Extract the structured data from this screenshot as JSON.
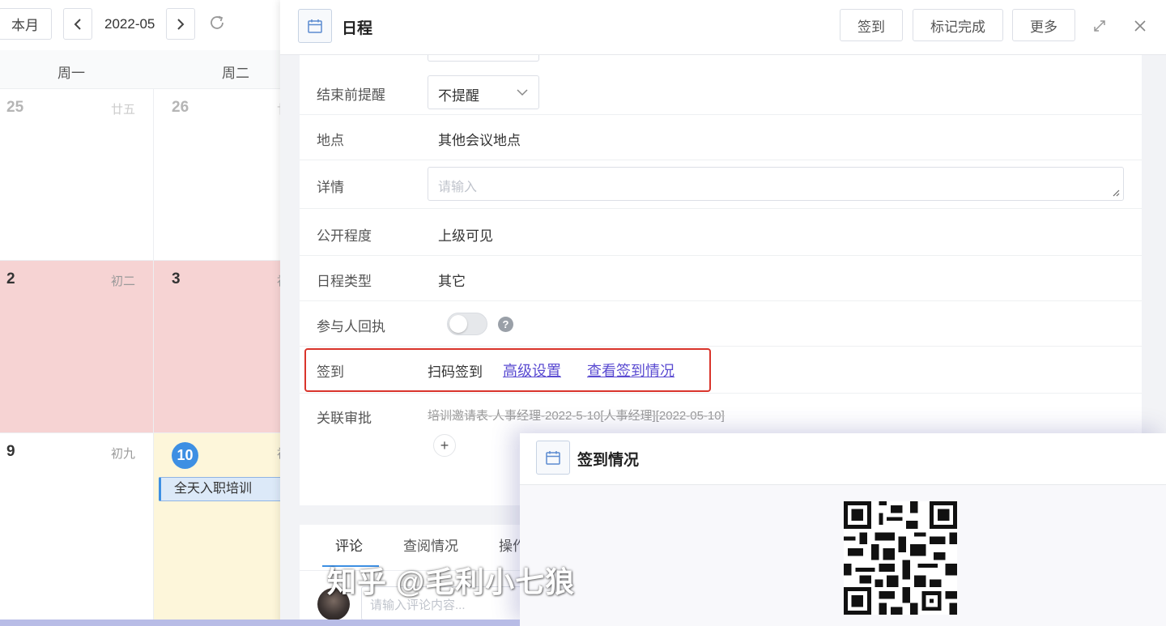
{
  "calendar": {
    "toolbar": {
      "this_month": "本月",
      "prev": "<",
      "month": "2022-05",
      "next": ">",
      "refresh_icon": "refresh-icon"
    },
    "weekdays": [
      "周一",
      "周二"
    ],
    "weeks": [
      {
        "mon": {
          "day": "25",
          "lunar": "廿五"
        },
        "tue": {
          "day": "26",
          "lunar": "廿"
        }
      },
      {
        "mon": {
          "day": "2",
          "lunar": "初二"
        },
        "tue": {
          "day": "3",
          "lunar": "初"
        }
      },
      {
        "mon": {
          "day": "9",
          "lunar": "初九"
        },
        "tue": {
          "day": "10",
          "lunar": "初"
        }
      }
    ],
    "event": "全天入职培训",
    "colors": {
      "holiday": "#f6d3d3",
      "today_col": "#fdf6da",
      "today_badge": "#3d8fe3"
    }
  },
  "drawer": {
    "title": "日程",
    "buttons": {
      "signin": "签到",
      "mark_done": "标记完成",
      "more": "更多"
    },
    "icons": {
      "calendar": "calendar-icon",
      "expand": "expand-icon",
      "close": "close-icon"
    },
    "fields": {
      "end_reminder": {
        "label": "结束前提醒",
        "value": "不提醒"
      },
      "location": {
        "label": "地点",
        "value": "其他会议地点"
      },
      "details": {
        "label": "详情",
        "placeholder": "请输入"
      },
      "visibility": {
        "label": "公开程度",
        "value": "上级可见"
      },
      "type": {
        "label": "日程类型",
        "value": "其它"
      },
      "rsvp": {
        "label": "参与人回执",
        "help": "?",
        "enabled": false
      },
      "signin": {
        "label": "签到",
        "value": "扫码签到",
        "advanced": "高级设置",
        "view_status": "查看签到情况"
      },
      "approval": {
        "label": "关联审批",
        "value": "培训邀请表-人事经理-2022-5-10[人事经理][2022-05-10]",
        "add": "+"
      }
    },
    "comments": {
      "tabs": [
        "评论",
        "查阅情况",
        "操作"
      ],
      "placeholder": "请输入评论内容..."
    }
  },
  "popup": {
    "title": "签到情况",
    "watermark": "知乎 @毛利小七狼"
  }
}
